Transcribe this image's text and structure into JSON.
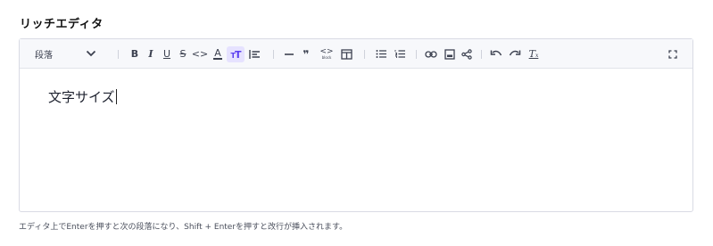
{
  "field": {
    "label": "リッチエディタ"
  },
  "toolbar": {
    "block_type": "段落",
    "accent_color": "#5b3ff0",
    "items": [
      {
        "name": "bold",
        "glyph": "B"
      },
      {
        "name": "italic",
        "glyph": "I"
      },
      {
        "name": "underline",
        "glyph": "U"
      },
      {
        "name": "strikethrough",
        "glyph": "S"
      },
      {
        "name": "inline-code",
        "glyph": "<>"
      },
      {
        "name": "text-color",
        "glyph": "A"
      },
      {
        "name": "font-size",
        "glyph": "TT",
        "active": true
      },
      {
        "name": "align",
        "glyph": "|="
      },
      {
        "name": "horizontal-rule",
        "glyph": "—"
      },
      {
        "name": "blockquote",
        "glyph": "❞"
      },
      {
        "name": "code-block",
        "glyph": "<>",
        "caption": "block"
      },
      {
        "name": "table",
        "glyph": "▦"
      },
      {
        "name": "bullet-list",
        "glyph": "≡"
      },
      {
        "name": "ordered-list",
        "glyph": "≡"
      },
      {
        "name": "link",
        "glyph": "⛓"
      },
      {
        "name": "image",
        "glyph": "▣"
      },
      {
        "name": "embed",
        "glyph": "<"
      },
      {
        "name": "undo",
        "glyph": "↶"
      },
      {
        "name": "redo",
        "glyph": "↷"
      },
      {
        "name": "clear-format",
        "glyph": "Tx"
      },
      {
        "name": "fullscreen",
        "glyph": "⛶"
      }
    ]
  },
  "editor": {
    "content": "文字サイズ"
  },
  "helper_text": "エディタ上でEnterを押すと次の段落になり、Shift + Enterを押すと改行が挿入されます。"
}
